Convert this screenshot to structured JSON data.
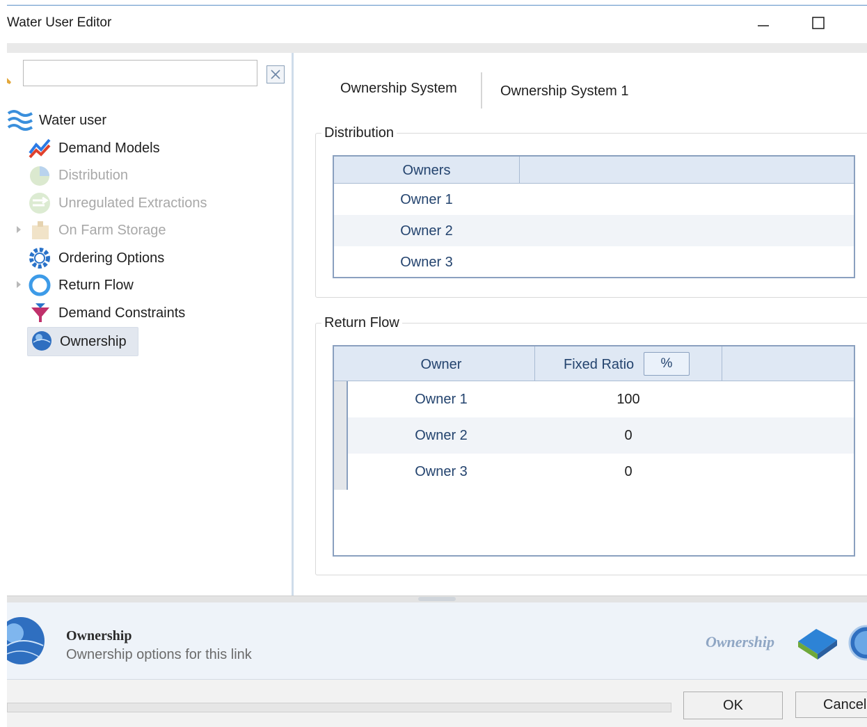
{
  "window": {
    "title": "Water User Editor",
    "minimize_label": "—",
    "maximize_label": "☐"
  },
  "search": {
    "value": "",
    "placeholder": ""
  },
  "tree": {
    "root": "Water user",
    "items": [
      {
        "label": "Demand Models",
        "icon": "demand-models-icon"
      },
      {
        "label": "Distribution",
        "icon": "distribution-icon"
      },
      {
        "label": "Unregulated Extractions",
        "icon": "extractions-icon"
      },
      {
        "label": "On Farm Storage",
        "icon": "storage-icon"
      },
      {
        "label": "Ordering Options",
        "icon": "gear-icon"
      },
      {
        "label": "Return Flow",
        "icon": "return-flow-icon"
      },
      {
        "label": "Demand Constraints",
        "icon": "funnel-icon"
      },
      {
        "label": "Ownership",
        "icon": "globe-icon"
      }
    ]
  },
  "main": {
    "tab_label": "Ownership System",
    "tab_value": "Ownership System 1",
    "distribution": {
      "title": "Distribution",
      "header": "Owners",
      "rows": [
        "Owner 1",
        "Owner 2",
        "Owner 3"
      ]
    },
    "return_flow": {
      "title": "Return Flow",
      "col_owner": "Owner",
      "col_ratio": "Fixed Ratio",
      "unit_button": "%",
      "rows": [
        {
          "owner": "Owner 1",
          "ratio": "100"
        },
        {
          "owner": "Owner 2",
          "ratio": "0"
        },
        {
          "owner": "Owner 3",
          "ratio": "0"
        }
      ]
    }
  },
  "info": {
    "title": "Ownership",
    "description": "Ownership options for this link",
    "right_label": "Ownership"
  },
  "buttons": {
    "ok": "OK",
    "cancel": "Cancel"
  },
  "colors": {
    "accent": "#2f6fc0",
    "grid_border": "#8aa0bf",
    "header_bg": "#dfe8f4",
    "cell_text": "#23436e"
  }
}
